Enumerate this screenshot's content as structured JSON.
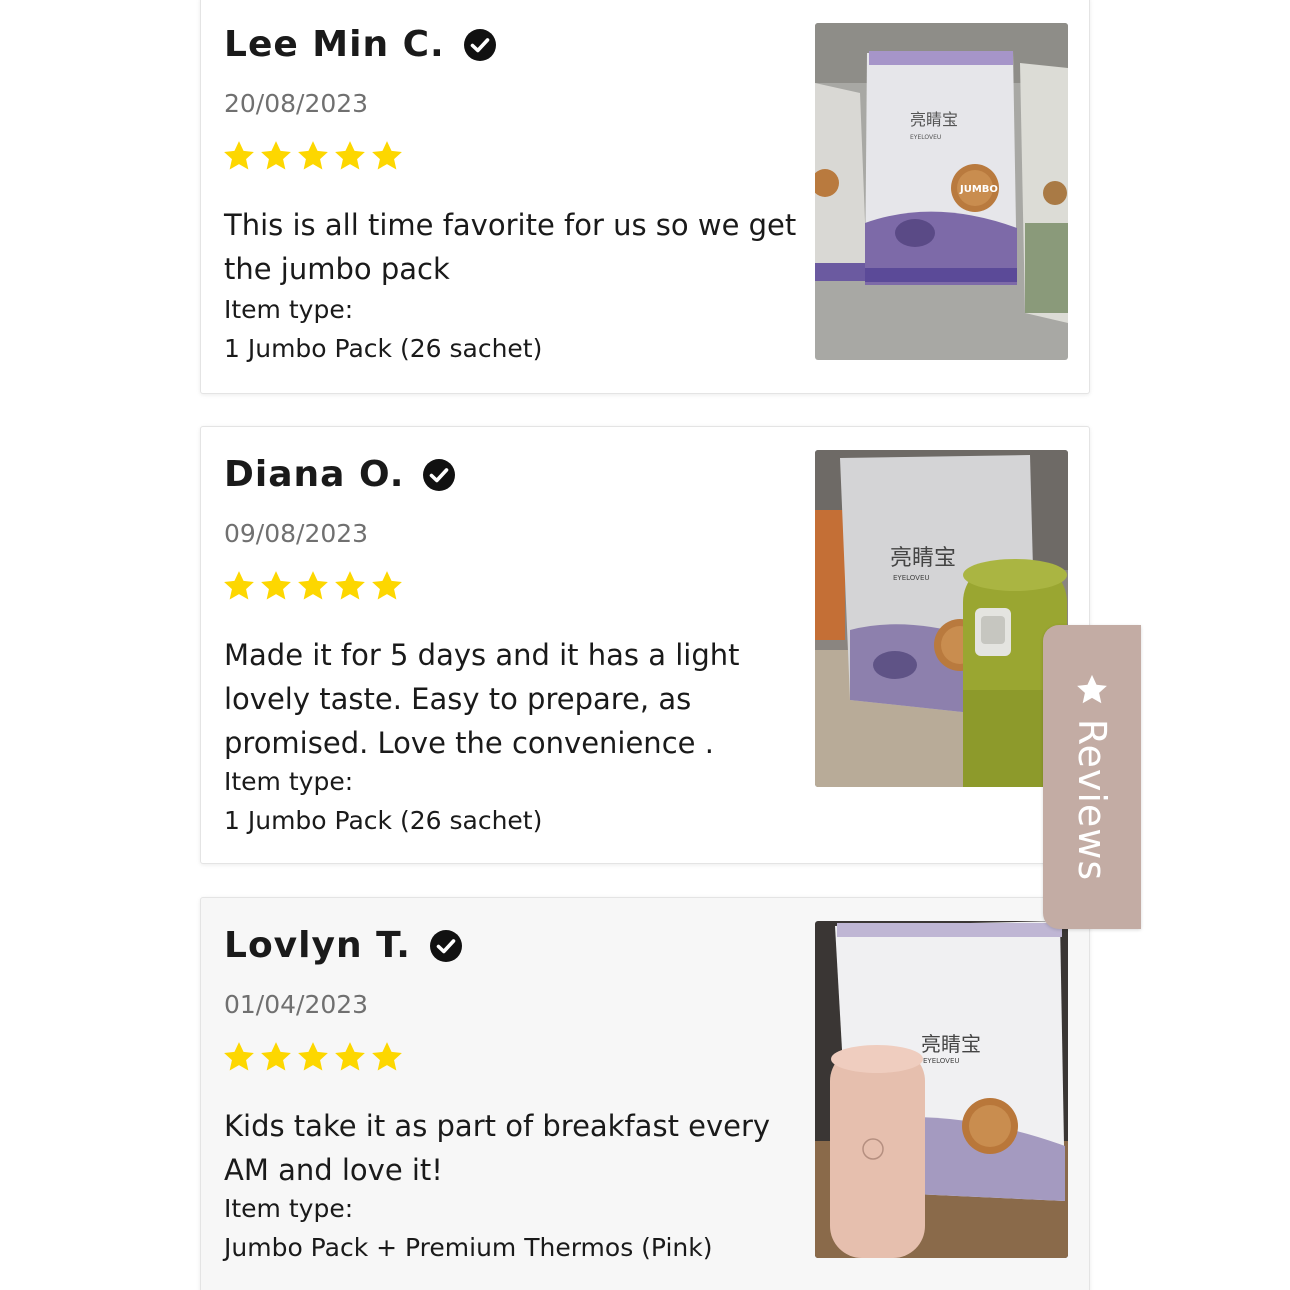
{
  "reviews": [
    {
      "author": "Lee Min C.",
      "date": "20/08/2023",
      "rating": 5,
      "body": "This is all time favorite for us so we get the jumbo pack",
      "item_type_label": "Item type:",
      "item_type_value": "1 Jumbo Pack (26 sachet)"
    },
    {
      "author": "Diana O.",
      "date": "09/08/2023",
      "rating": 5,
      "body": "Made it for 5 days and it has a light lovely taste. Easy to prepare, as promised. Love the convenience .",
      "item_type_label": "Item type:",
      "item_type_value": "1 Jumbo Pack (26 sachet)"
    },
    {
      "author": "Lovlyn T.",
      "date": "01/04/2023",
      "rating": 5,
      "body": "Kids take it as part of breakfast every AM and love it!",
      "item_type_label": "Item type:",
      "item_type_value": "Jumbo Pack + Premium Thermos (Pink)"
    }
  ],
  "reviews_tab": {
    "label": "Reviews",
    "icon": "star-icon"
  },
  "colors": {
    "star": "#fdd700",
    "verified": "#111111",
    "tab_bg": "#c3aca4",
    "date": "#707070"
  }
}
